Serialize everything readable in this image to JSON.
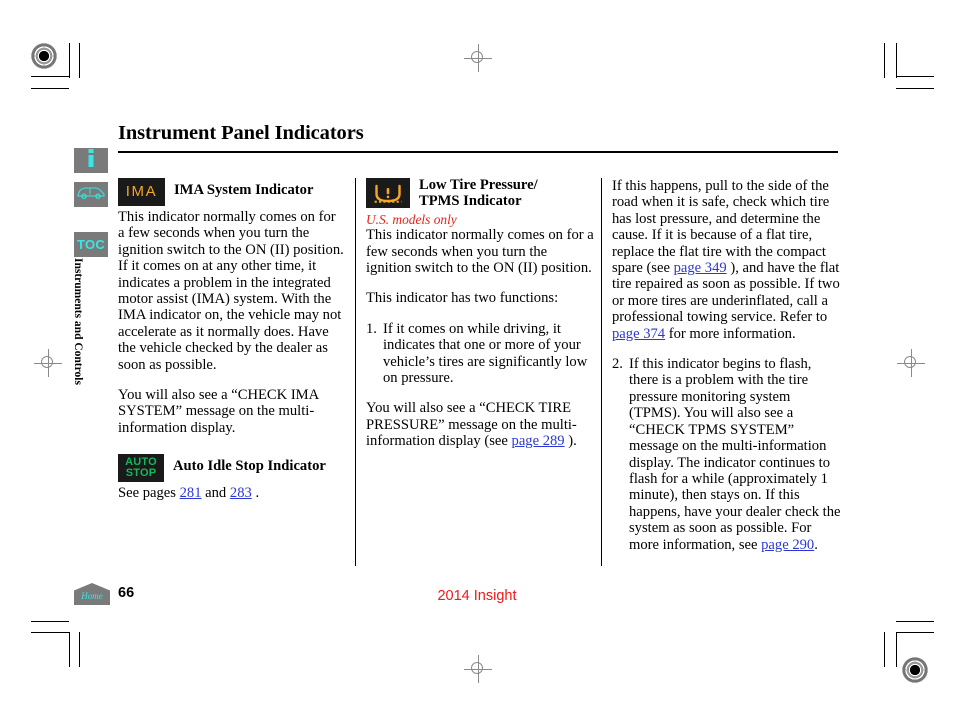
{
  "page": {
    "title": "Instrument Panel Indicators",
    "number": "66",
    "model": "2014 Insight"
  },
  "sidebar": {
    "items": [
      {
        "name": "info-tab",
        "icon": "info-icon"
      },
      {
        "name": "vehicle-tab",
        "icon": "car-icon"
      },
      {
        "name": "toc-tab",
        "icon": "toc-icon",
        "label": "TOC"
      }
    ],
    "section_label": "Instruments and Controls"
  },
  "columns": {
    "left": {
      "indicators": [
        {
          "glyph_text": "IMA",
          "title": "IMA System Indicator",
          "paragraphs": [
            "This indicator normally comes on for a few seconds when you turn the ignition switch to the ON (II) position. If it comes on at any other time, it indicates a problem in the integrated motor assist (IMA) system. With the IMA indicator on, the vehicle may not accelerate as it normally does. Have the vehicle checked by the dealer as soon as possible.",
            "You will also see a “CHECK IMA SYSTEM” message on the multi-information display."
          ]
        },
        {
          "glyph_line1": "AUTO",
          "glyph_line2": "STOP",
          "title": "Auto Idle Stop Indicator",
          "see_prefix": "See pages",
          "link1": "281",
          "between": "and",
          "link2": "283",
          "suffix": "."
        }
      ]
    },
    "middle": {
      "indicator": {
        "glyph": "tire-pressure-icon",
        "title_line1": "Low Tire Pressure/",
        "title_line2": "TPMS Indicator",
        "note": "U.S. models only",
        "paragraphs": [
          "This indicator normally comes on for a few seconds when you turn the ignition switch to the ON (II) position.",
          "This indicator has two functions:"
        ],
        "list": [
          {
            "num": "1.",
            "text": "If it comes on while driving, it indicates that one or more of your vehicle’s tires are significantly low on pressure."
          }
        ],
        "closing_pre": "You will also see a “CHECK TIRE PRESSURE” message on the multi-information display (see",
        "closing_link": "page 289",
        "closing_post": ")."
      }
    },
    "right": {
      "paragraph_pre": "If this happens, pull to the side of the road when it is safe, check which tire has lost pressure, and determine the cause. If it is because of a flat tire, replace the flat tire with the compact spare (see",
      "paragraph_link1": "page 349",
      "paragraph_mid": "), and have the flat tire repaired as soon as possible. If two or more tires are underinflated, call a professional towing service. Refer to",
      "paragraph_link2": "page 374",
      "paragraph_post": "for more information.",
      "list": [
        {
          "num": "2.",
          "text_pre": "If this indicator begins to flash, there is a problem with the tire pressure monitoring system (TPMS). You will also see a “CHECK TPMS SYSTEM” message on the multi-information display. The indicator continues to flash for a while (approximately 1 minute), then stays on. If this happens, have your dealer check the system as soon as possible. For more information, see",
          "link": "page 290",
          "text_post": "."
        }
      ]
    }
  },
  "colors": {
    "accent_link": "#2b37d4",
    "note_red": "#e8241a",
    "model_red": "#f01818",
    "tab_gray": "#7a7a7a",
    "tab_cyan": "#39e6e6",
    "amber": "#f5a623",
    "green": "#14b85a"
  }
}
